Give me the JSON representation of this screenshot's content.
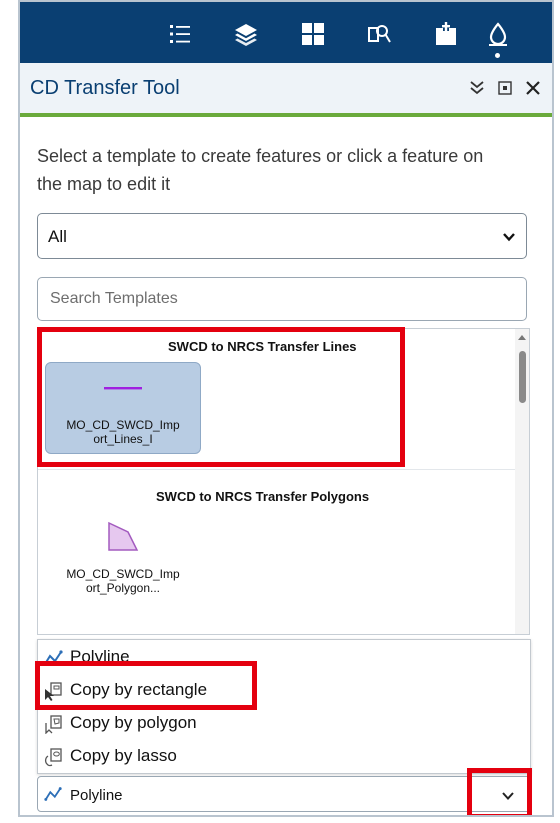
{
  "toolbar": {
    "icons": [
      "list-icon",
      "layers-icon",
      "grid-icon",
      "search-document-icon",
      "add-bookmark-icon",
      "drop-icon"
    ],
    "active_icon": "drop-icon",
    "background_color": "#0a3f72"
  },
  "panel": {
    "title": "CD Transfer Tool",
    "header_buttons": [
      "collapse-icon",
      "maximize-icon",
      "close-icon"
    ],
    "accent_color": "#6aaa3b"
  },
  "instructions": "Select a template to create features or click a feature on the map to edit it",
  "filter": {
    "selected": "All"
  },
  "search": {
    "placeholder": "Search Templates",
    "value": ""
  },
  "template_groups": [
    {
      "title": "SWCD to NRCS Transfer Lines",
      "templates": [
        {
          "name_line1": "MO_CD_SWCD_Imp",
          "name_line2": "ort_Lines_I",
          "symbol": "line",
          "symbol_color": "#a020e0",
          "selected": true
        }
      ]
    },
    {
      "title": "SWCD to NRCS Transfer Polygons",
      "templates": [
        {
          "name_line1": "MO_CD_SWCD_Imp",
          "name_line2": "ort_Polygon...",
          "symbol": "polygon",
          "symbol_color": "#e6c8ef",
          "selected": false
        }
      ]
    }
  ],
  "tool_options": [
    {
      "label": "Polyline",
      "icon": "polyline-icon"
    },
    {
      "label": "Copy by rectangle",
      "icon": "copy-rectangle-icon"
    },
    {
      "label": "Copy by polygon",
      "icon": "copy-polygon-icon"
    },
    {
      "label": "Copy by lasso",
      "icon": "copy-lasso-icon"
    }
  ],
  "tool_select": {
    "selected": "Polyline",
    "icon": "polyline-icon"
  },
  "highlight_color": "#e4000f"
}
